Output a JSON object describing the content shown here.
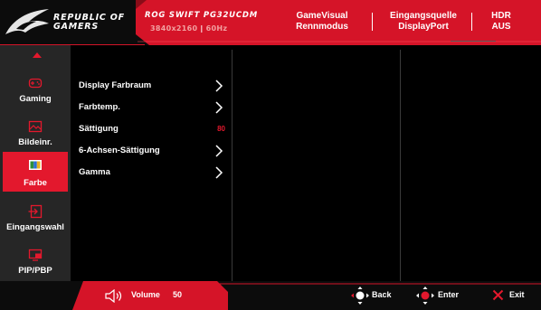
{
  "header": {
    "brand_line1": "REPUBLIC OF",
    "brand_line2": "GAMERS",
    "model_name": "ROG SWIFT PG32UCDM",
    "resolution": "3840x2160",
    "refresh_rate": "60Hz",
    "gamevisual_label": "GameVisual",
    "gamevisual_value": "Rennmodus",
    "input_label": "Eingangsquelle",
    "input_value": "DisplayPort",
    "hdr_label": "HDR",
    "hdr_value": "AUS"
  },
  "sidebar": {
    "items": [
      {
        "label": "Gaming",
        "icon": "gamepad-icon"
      },
      {
        "label": "Bildeinr.",
        "icon": "image-icon"
      },
      {
        "label": "Farbe",
        "icon": "color-icon",
        "active": true
      },
      {
        "label": "Eingangswahl",
        "icon": "input-icon"
      },
      {
        "label": "PIP/PBP",
        "icon": "pip-icon"
      }
    ]
  },
  "menu": {
    "items": [
      {
        "label": "Display Farbraum",
        "type": "submenu"
      },
      {
        "label": "Farbtemp.",
        "type": "submenu"
      },
      {
        "label": "Sättigung",
        "type": "value",
        "value": "80"
      },
      {
        "label": "6-Achsen-Sättigung",
        "type": "submenu"
      },
      {
        "label": "Gamma",
        "type": "submenu"
      }
    ]
  },
  "footer": {
    "volume_label": "Volume",
    "volume_value": "50",
    "back_label": "Back",
    "enter_label": "Enter",
    "exit_label": "Exit"
  },
  "colors": {
    "accent": "#e3182d",
    "sidebar_bg": "#262626",
    "background": "#000000"
  }
}
